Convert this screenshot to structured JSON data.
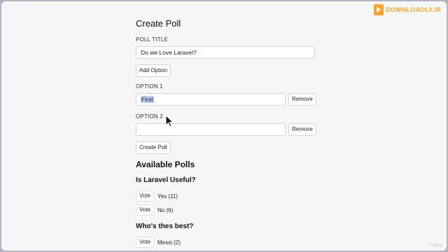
{
  "logo": {
    "text": "DOWNLOADLY.IR",
    "accent": "#f4a531"
  },
  "create_poll": {
    "heading": "Create Poll",
    "poll_title_label": "POLL TITLE",
    "poll_title_value": "Do we Love Laravel?",
    "add_option_label": "Add Option",
    "options": [
      {
        "label": "OPTION 1",
        "value": "First",
        "remove_label": "Remove"
      },
      {
        "label": "OPTION 2",
        "value": "",
        "remove_label": "Remove"
      }
    ],
    "submit_label": "Create Poll"
  },
  "available": {
    "heading": "Available Polls",
    "polls": [
      {
        "question": "Is Laravel Useful?",
        "options": [
          {
            "vote_label": "Vote",
            "text": "Yes (11)"
          },
          {
            "vote_label": "Vote",
            "text": "No (6)"
          }
        ]
      },
      {
        "question": "Who's thes best?",
        "options": [
          {
            "vote_label": "Vote",
            "text": "Messi (2)"
          }
        ]
      }
    ]
  },
  "watermark": "Udemy"
}
